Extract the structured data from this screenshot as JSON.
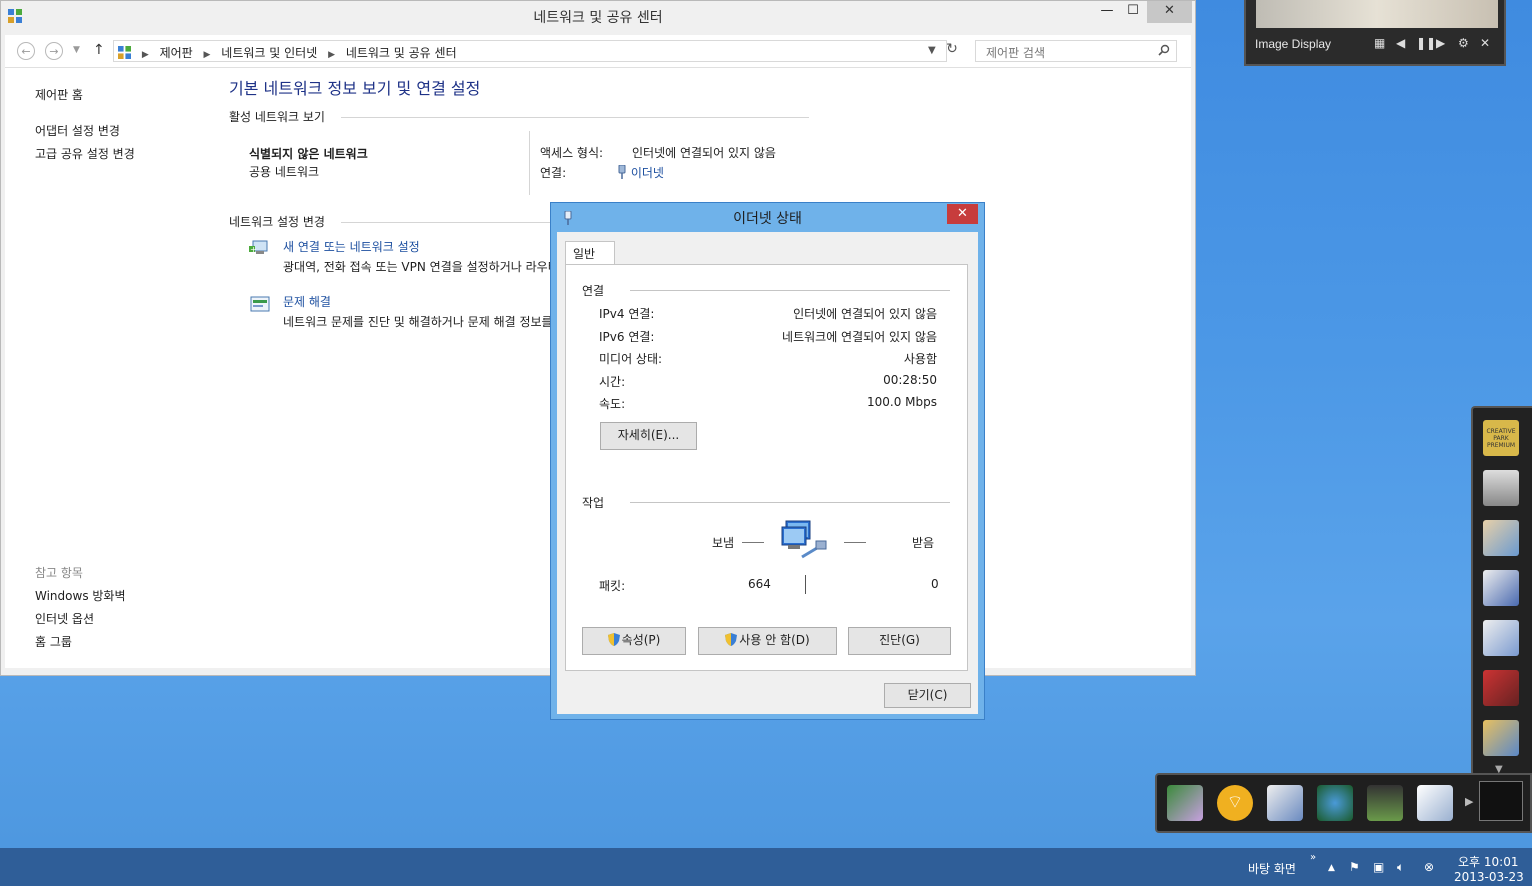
{
  "control_panel": {
    "title": "네트워크 및 공유 센터",
    "window_buttons": {
      "minimize": "—",
      "maximize": "☐",
      "close": "✕"
    },
    "breadcrumb": [
      "제어판",
      "네트워크 및 인터넷",
      "네트워크 및 공유 센터"
    ],
    "search_placeholder": "제어판 검색",
    "sidebar": {
      "home": "제어판 홈",
      "items": [
        "어댑터 설정 변경",
        "고급 공유 설정 변경"
      ],
      "see_also_label": "참고 항목",
      "see_also": [
        "Windows 방화벽",
        "인터넷 옵션",
        "홈 그룹"
      ]
    },
    "main": {
      "title": "기본 네트워크 정보 보기 및 연결 설정",
      "active_networks_heading": "활성 네트워크 보기",
      "network_name": "식별되지 않은 네트워크",
      "network_type": "공용 네트워크",
      "access_type_label": "액세스 형식:",
      "access_type_value": "인터넷에 연결되어 있지 않음",
      "connection_label": "연결:",
      "connection_value": "이더넷",
      "change_settings_heading": "네트워크 설정 변경",
      "tasks": [
        {
          "title": "새 연결 또는 네트워크 설정",
          "desc": "광대역, 전화 접속 또는 VPN 연결을 설정하거나 라우터 또는 액세스 지점을 설정합니다."
        },
        {
          "title": "문제 해결",
          "desc": "네트워크 문제를 진단 및 해결하거나 문제 해결 정보를 확인합니다."
        }
      ]
    }
  },
  "dialog": {
    "title": "이더넷 상태",
    "tab": "일반",
    "connection_heading": "연결",
    "status_rows": [
      {
        "label": "IPv4 연결:",
        "value": "인터넷에 연결되어 있지 않음"
      },
      {
        "label": "IPv6 연결:",
        "value": "네트워크에 연결되어 있지 않음"
      },
      {
        "label": "미디어 상태:",
        "value": "사용함"
      },
      {
        "label": "시간:",
        "value": "00:28:50"
      },
      {
        "label": "속도:",
        "value": "100.0 Mbps"
      }
    ],
    "details_button": "자세히(E)...",
    "activity_heading": "작업",
    "sent_label": "보냄",
    "received_label": "받음",
    "packets_label": "패킷:",
    "packets_sent": "664",
    "packets_received": "0",
    "properties_button": "속성(P)",
    "disable_button": "사용 안 함(D)",
    "diagnose_button": "진단(G)",
    "close_button": "닫기(C)"
  },
  "gadget": {
    "label": "Image Display"
  },
  "launcher": {
    "top_app_text": "CREATIVE PARK PREMIUM",
    "icons": [
      "creative-park-icon",
      "printer-tools-icon",
      "photo-album-icon",
      "photo-print-icon",
      "photo-layout-icon",
      "photo-frame-icon",
      "photo-edit-icon"
    ]
  },
  "tray_apps": [
    "solution-menu-icon",
    "wireless-setup-icon",
    "my-printer-icon",
    "web-shop-icon",
    "printer-driver-icon",
    "help-manual-icon"
  ],
  "taskbar": {
    "desktop_toolbar": "바탕 화면",
    "time": "오후 10:01",
    "date": "2013-03-23"
  },
  "colors": {
    "accent_blue": "#1e50a0",
    "title_blue": "#1e3287",
    "dialog_frame": "#6fb2ea",
    "taskbar": "#2f5e98",
    "close_red": "#c73c3c"
  }
}
